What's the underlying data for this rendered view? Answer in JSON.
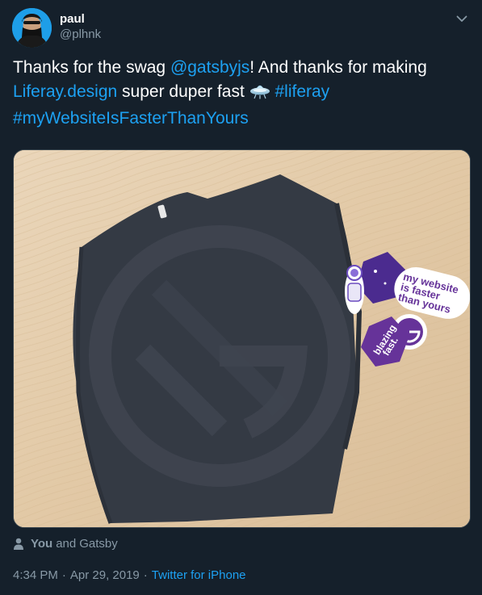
{
  "author": {
    "display_name": "paul",
    "handle": "@plhnk"
  },
  "tweet": {
    "text_1": "Thanks for the swag ",
    "mention": "@gatsbyjs",
    "text_2": "! And thanks for making ",
    "link": "Liferay.design",
    "text_3": " super duper fast ",
    "emoji": "ufo",
    "hashtag_1": "#liferay",
    "hashtag_2": "#myWebsiteIsFasterThanYours"
  },
  "image": {
    "sticker_1": "my website is faster than yours",
    "sticker_2": "blazing fast."
  },
  "tagged": {
    "you": "You",
    "and": "and",
    "other": "Gatsby"
  },
  "meta": {
    "time": "4:34 PM",
    "date": "Apr 29, 2019",
    "separator": "·",
    "source": "Twitter for iPhone"
  },
  "colors": {
    "background": "#15202b",
    "link": "#1da1f2",
    "secondary_text": "#8899a6"
  }
}
